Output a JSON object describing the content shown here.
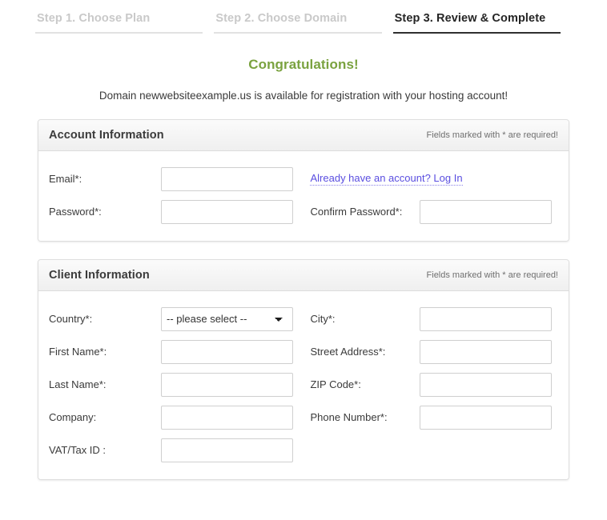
{
  "wizard": {
    "steps": [
      {
        "label": "Step 1. Choose Plan",
        "state": "done"
      },
      {
        "label": "Step 2. Choose Domain",
        "state": "done"
      },
      {
        "label": "Step 3. Review & Complete",
        "state": "active"
      }
    ]
  },
  "heading": {
    "congratulations": "Congratulations!",
    "subtitle": "Domain newwebsiteexample.us is available for registration with your hosting account!",
    "congratulations_color": "#7aa23f"
  },
  "account_panel": {
    "title": "Account Information",
    "required_note": "Fields marked with * are required!",
    "email_label": "Email*:",
    "email_value": "",
    "password_label": "Password*:",
    "password_value": "",
    "confirm_password_label": "Confirm Password*:",
    "confirm_password_value": "",
    "login_link": "Already have an account? Log In"
  },
  "client_panel": {
    "title": "Client Information",
    "required_note": "Fields marked with * are required!",
    "country_label": "Country*:",
    "country_selected": "-- please select --",
    "country_options": [
      "-- please select --"
    ],
    "city_label": "City*:",
    "city_value": "",
    "first_name_label": "First Name*:",
    "first_name_value": "",
    "street_address_label": "Street Address*:",
    "street_address_value": "",
    "last_name_label": "Last Name*:",
    "last_name_value": "",
    "zip_code_label": "ZIP Code*:",
    "zip_code_value": "",
    "company_label": "Company:",
    "company_value": "",
    "phone_label": "Phone Number*:",
    "phone_value": "",
    "vat_label": "VAT/Tax ID :",
    "vat_value": ""
  }
}
